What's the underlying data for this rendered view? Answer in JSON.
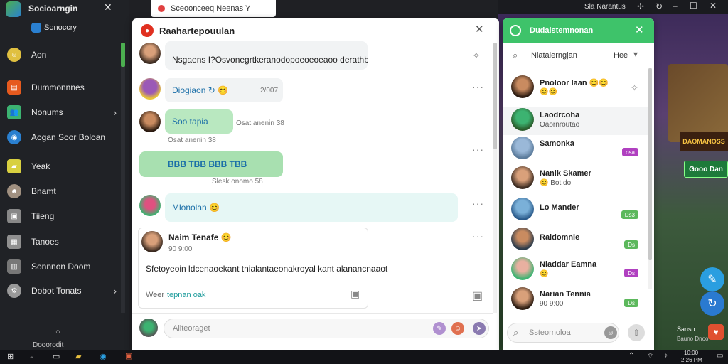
{
  "topbar": {
    "app_name": "Socioarngin",
    "right_text": "Sla Narantus"
  },
  "sidebar": {
    "account": "Sonoccry",
    "items": [
      {
        "label": "Aon",
        "color": "#e0c040"
      },
      {
        "label": "Dummonnnes",
        "color": "#e65a1e"
      },
      {
        "label": "Nonums",
        "color": "#3cb371"
      },
      {
        "label": "Aogan Soor Boloan",
        "color": "#2a80d0"
      },
      {
        "label": "Yeak",
        "color": "#d8d040"
      },
      {
        "label": "Bnamt",
        "color": "#a09080"
      },
      {
        "label": "Tiieng",
        "color": "#888888"
      },
      {
        "label": "Tanoes",
        "color": "#909090"
      },
      {
        "label": "Sonnnon Doom",
        "color": "#777777"
      },
      {
        "label": "Dobot Tonats",
        "color": "#999999"
      }
    ],
    "footer": "Dooorodit"
  },
  "search_tab": {
    "label": "Sceoonceeq Neenas Y"
  },
  "chat": {
    "title": "Raahartepouulan",
    "messages": [
      {
        "text": "Nsgaens I?Osvonegrtkeranodopoeoeoeaoo derathbod",
        "stars": "★★★"
      },
      {
        "text": "Diogiaon ↻ 😊",
        "time": "2/007"
      },
      {
        "text": "Soo tapia",
        "meta": "Osat anenin 38"
      },
      {
        "text": "BBB TBB BBB TBB",
        "meta": "Slesk onomo 58"
      },
      {
        "text": "Mlonolan 😊"
      }
    ],
    "post": {
      "name": "Naim Tenafe 😊",
      "time": "90 9:00",
      "body": "Sfetoyeoin ldcenaoekant tnialantaeonakroyal kant alanancnaaot",
      "footer_left": "Weer",
      "footer_link": "tepnan oak"
    },
    "composer_placeholder": "Aliteoraget"
  },
  "contacts": {
    "title": "Dudalstemnonan",
    "search_label": "Nlatalerngjan",
    "search_right": "Hee",
    "items": [
      {
        "name": "Pnoloor laan 😊😊",
        "sub": "😊😊",
        "badge": "",
        "badge_color": ""
      },
      {
        "name": "Laodrcoha",
        "sub": "Oaornroutao",
        "badge": "",
        "badge_color": ""
      },
      {
        "name": "Samonka",
        "sub": "",
        "badge": "osa",
        "badge_color": "#b040c0"
      },
      {
        "name": "Nanik Skamer",
        "sub": "😊 Bot do",
        "badge": "",
        "badge_color": ""
      },
      {
        "name": "Lo Mander",
        "sub": "",
        "badge": "Ds3",
        "badge_color": "#5cb85c"
      },
      {
        "name": "Raldomnie",
        "sub": "",
        "badge": "Ds",
        "badge_color": "#5cb85c"
      },
      {
        "name": "Nladdar Eamna",
        "sub": "😊",
        "badge": "Ds",
        "badge_color": "#b040c0"
      },
      {
        "name": "Narian Tennia",
        "sub": "90 9:00",
        "badge": "Ds",
        "badge_color": "#5cb85c"
      }
    ],
    "search_placeholder": "Ssteornoloa"
  },
  "game": {
    "sign_text": "DAOMANOSS",
    "button_label": "Gooo Dan",
    "bottom_text": "Sanso",
    "bottom_sub": "Bauno Dnoo"
  },
  "taskbar": {
    "time": "10:00",
    "date": "2:26 PM"
  }
}
